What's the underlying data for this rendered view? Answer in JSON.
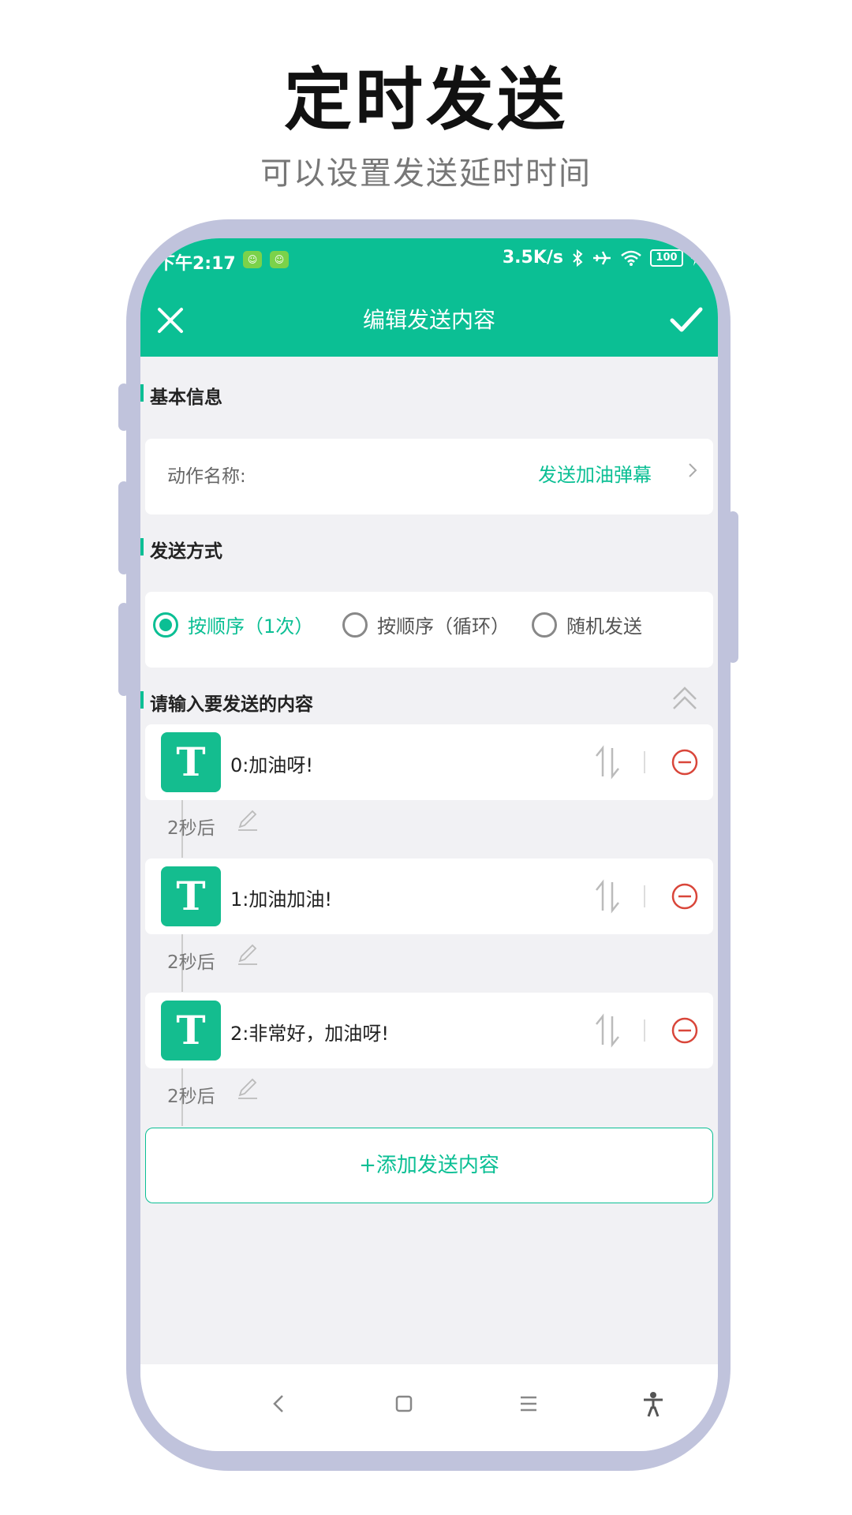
{
  "promo": {
    "title": "定时发送",
    "subtitle": "可以设置发送延时时间"
  },
  "status_bar": {
    "time": "下午2:17",
    "network_speed": "3.5K/s",
    "battery": "100",
    "icons": [
      "app-icon",
      "app-icon",
      "bluetooth-icon",
      "airplane-icon",
      "wifi-icon",
      "battery-icon",
      "charging-icon"
    ]
  },
  "header": {
    "title": "编辑发送内容",
    "close_icon": "close-icon",
    "confirm_icon": "check-icon"
  },
  "basic_info": {
    "section_title": "基本信息",
    "action_label": "动作名称:",
    "action_value": "发送加油弹幕"
  },
  "send_mode": {
    "section_title": "发送方式",
    "options": [
      {
        "label": "按顺序（1次）",
        "selected": true
      },
      {
        "label": "按顺序（循环）",
        "selected": false
      },
      {
        "label": "随机发送",
        "selected": false
      }
    ]
  },
  "content": {
    "section_title": "请输入要发送的内容",
    "items": [
      {
        "icon_letter": "T",
        "text": "0:加油呀!",
        "delay": "2秒后"
      },
      {
        "icon_letter": "T",
        "text": "1:加油加油!",
        "delay": "2秒后"
      },
      {
        "icon_letter": "T",
        "text": "2:非常好，加油呀!",
        "delay": "2秒后"
      }
    ],
    "add_button": "+添加发送内容"
  },
  "colors": {
    "accent": "#0bbf94",
    "remove": "#d9463a",
    "frame": "#c0c3dc"
  }
}
